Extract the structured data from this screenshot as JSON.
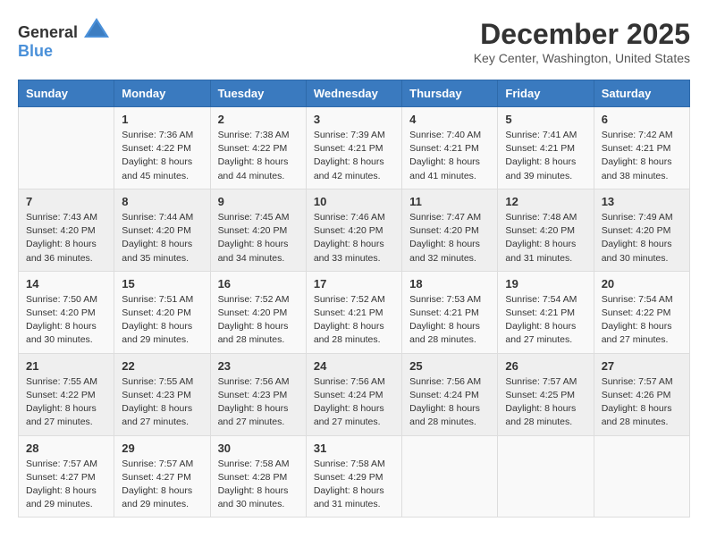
{
  "logo": {
    "general": "General",
    "blue": "Blue"
  },
  "title": "December 2025",
  "location": "Key Center, Washington, United States",
  "days_header": [
    "Sunday",
    "Monday",
    "Tuesday",
    "Wednesday",
    "Thursday",
    "Friday",
    "Saturday"
  ],
  "weeks": [
    [
      {
        "day": "",
        "content": ""
      },
      {
        "day": "1",
        "content": "Sunrise: 7:36 AM\nSunset: 4:22 PM\nDaylight: 8 hours\nand 45 minutes."
      },
      {
        "day": "2",
        "content": "Sunrise: 7:38 AM\nSunset: 4:22 PM\nDaylight: 8 hours\nand 44 minutes."
      },
      {
        "day": "3",
        "content": "Sunrise: 7:39 AM\nSunset: 4:21 PM\nDaylight: 8 hours\nand 42 minutes."
      },
      {
        "day": "4",
        "content": "Sunrise: 7:40 AM\nSunset: 4:21 PM\nDaylight: 8 hours\nand 41 minutes."
      },
      {
        "day": "5",
        "content": "Sunrise: 7:41 AM\nSunset: 4:21 PM\nDaylight: 8 hours\nand 39 minutes."
      },
      {
        "day": "6",
        "content": "Sunrise: 7:42 AM\nSunset: 4:21 PM\nDaylight: 8 hours\nand 38 minutes."
      }
    ],
    [
      {
        "day": "7",
        "content": "Sunrise: 7:43 AM\nSunset: 4:20 PM\nDaylight: 8 hours\nand 36 minutes."
      },
      {
        "day": "8",
        "content": "Sunrise: 7:44 AM\nSunset: 4:20 PM\nDaylight: 8 hours\nand 35 minutes."
      },
      {
        "day": "9",
        "content": "Sunrise: 7:45 AM\nSunset: 4:20 PM\nDaylight: 8 hours\nand 34 minutes."
      },
      {
        "day": "10",
        "content": "Sunrise: 7:46 AM\nSunset: 4:20 PM\nDaylight: 8 hours\nand 33 minutes."
      },
      {
        "day": "11",
        "content": "Sunrise: 7:47 AM\nSunset: 4:20 PM\nDaylight: 8 hours\nand 32 minutes."
      },
      {
        "day": "12",
        "content": "Sunrise: 7:48 AM\nSunset: 4:20 PM\nDaylight: 8 hours\nand 31 minutes."
      },
      {
        "day": "13",
        "content": "Sunrise: 7:49 AM\nSunset: 4:20 PM\nDaylight: 8 hours\nand 30 minutes."
      }
    ],
    [
      {
        "day": "14",
        "content": "Sunrise: 7:50 AM\nSunset: 4:20 PM\nDaylight: 8 hours\nand 30 minutes."
      },
      {
        "day": "15",
        "content": "Sunrise: 7:51 AM\nSunset: 4:20 PM\nDaylight: 8 hours\nand 29 minutes."
      },
      {
        "day": "16",
        "content": "Sunrise: 7:52 AM\nSunset: 4:20 PM\nDaylight: 8 hours\nand 28 minutes."
      },
      {
        "day": "17",
        "content": "Sunrise: 7:52 AM\nSunset: 4:21 PM\nDaylight: 8 hours\nand 28 minutes."
      },
      {
        "day": "18",
        "content": "Sunrise: 7:53 AM\nSunset: 4:21 PM\nDaylight: 8 hours\nand 28 minutes."
      },
      {
        "day": "19",
        "content": "Sunrise: 7:54 AM\nSunset: 4:21 PM\nDaylight: 8 hours\nand 27 minutes."
      },
      {
        "day": "20",
        "content": "Sunrise: 7:54 AM\nSunset: 4:22 PM\nDaylight: 8 hours\nand 27 minutes."
      }
    ],
    [
      {
        "day": "21",
        "content": "Sunrise: 7:55 AM\nSunset: 4:22 PM\nDaylight: 8 hours\nand 27 minutes."
      },
      {
        "day": "22",
        "content": "Sunrise: 7:55 AM\nSunset: 4:23 PM\nDaylight: 8 hours\nand 27 minutes."
      },
      {
        "day": "23",
        "content": "Sunrise: 7:56 AM\nSunset: 4:23 PM\nDaylight: 8 hours\nand 27 minutes."
      },
      {
        "day": "24",
        "content": "Sunrise: 7:56 AM\nSunset: 4:24 PM\nDaylight: 8 hours\nand 27 minutes."
      },
      {
        "day": "25",
        "content": "Sunrise: 7:56 AM\nSunset: 4:24 PM\nDaylight: 8 hours\nand 28 minutes."
      },
      {
        "day": "26",
        "content": "Sunrise: 7:57 AM\nSunset: 4:25 PM\nDaylight: 8 hours\nand 28 minutes."
      },
      {
        "day": "27",
        "content": "Sunrise: 7:57 AM\nSunset: 4:26 PM\nDaylight: 8 hours\nand 28 minutes."
      }
    ],
    [
      {
        "day": "28",
        "content": "Sunrise: 7:57 AM\nSunset: 4:27 PM\nDaylight: 8 hours\nand 29 minutes."
      },
      {
        "day": "29",
        "content": "Sunrise: 7:57 AM\nSunset: 4:27 PM\nDaylight: 8 hours\nand 29 minutes."
      },
      {
        "day": "30",
        "content": "Sunrise: 7:58 AM\nSunset: 4:28 PM\nDaylight: 8 hours\nand 30 minutes."
      },
      {
        "day": "31",
        "content": "Sunrise: 7:58 AM\nSunset: 4:29 PM\nDaylight: 8 hours\nand 31 minutes."
      },
      {
        "day": "",
        "content": ""
      },
      {
        "day": "",
        "content": ""
      },
      {
        "day": "",
        "content": ""
      }
    ]
  ]
}
